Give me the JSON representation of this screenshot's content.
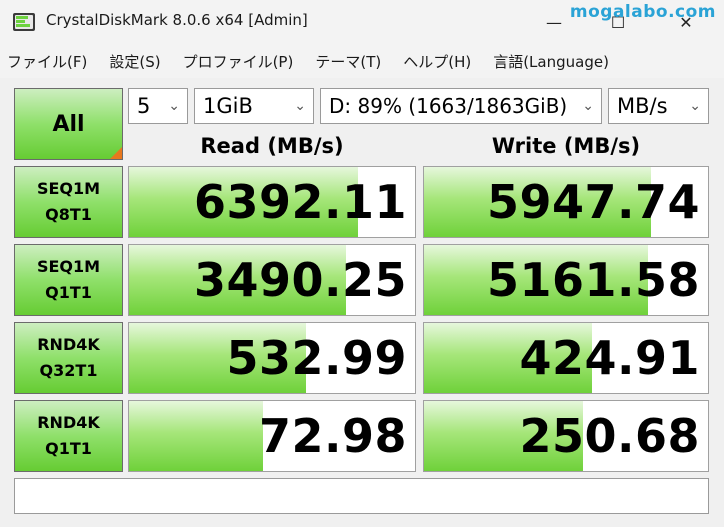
{
  "window": {
    "title": "CrystalDiskMark 8.0.6 x64 [Admin]",
    "minimize_glyph": "—",
    "maximize_glyph": "☐",
    "close_glyph": "✕",
    "watermark": "mogalabo.com"
  },
  "menu": {
    "items": [
      {
        "label": "ファイル(F)"
      },
      {
        "label": "設定(S)"
      },
      {
        "label": "プロファイル(P)"
      },
      {
        "label": "テーマ(T)"
      },
      {
        "label": "ヘルプ(H)"
      },
      {
        "label": "言語(Language)"
      }
    ]
  },
  "controls": {
    "all_label": "All",
    "count": "5",
    "size": "1GiB",
    "drive": "D: 89% (1663/1863GiB)",
    "unit": "MB/s",
    "chevron": "⌄"
  },
  "headers": {
    "read": "Read (MB/s)",
    "write": "Write (MB/s)"
  },
  "tests": [
    {
      "line1": "SEQ1M",
      "line2": "Q8T1",
      "read": "6392.11",
      "write": "5947.74",
      "read_fill": 0.8,
      "write_fill": 0.8
    },
    {
      "line1": "SEQ1M",
      "line2": "Q1T1",
      "read": "3490.25",
      "write": "5161.58",
      "read_fill": 0.76,
      "write_fill": 0.79
    },
    {
      "line1": "RND4K",
      "line2": "Q32T1",
      "read": "532.99",
      "write": "424.91",
      "read_fill": 0.62,
      "write_fill": 0.59
    },
    {
      "line1": "RND4K",
      "line2": "Q1T1",
      "read": "72.98",
      "write": "250.68",
      "read_fill": 0.47,
      "write_fill": 0.56
    }
  ],
  "comment": "",
  "colors": {
    "accent_green": "#66cc33",
    "corner_orange": "#e8781e",
    "watermark_blue": "#2aa3d6"
  }
}
